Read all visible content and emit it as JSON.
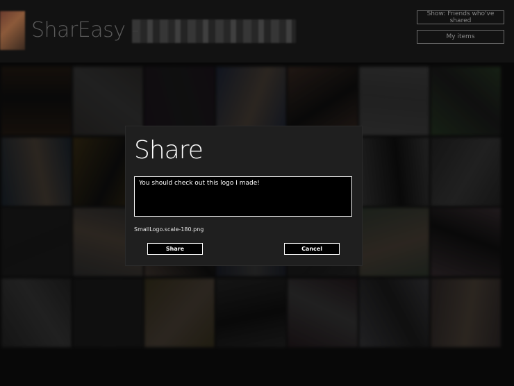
{
  "app": {
    "title": "SharEasy -"
  },
  "header": {
    "filter_button_label": "Show: Friends who've shared",
    "my_items_button_label": "My items"
  },
  "dialog": {
    "title": "Share",
    "message": "You should check out this logo I made!",
    "filename": "SmallLogo.scale-180.png",
    "share_label": "Share",
    "cancel_label": "Cancel"
  },
  "tiles": [
    "#3b2b1f",
    "#4a4744",
    "#2e2030",
    "#2f3b58",
    "#5a4236",
    "#6a6a6a",
    "#3f5a3a",
    "#2a3a4a",
    "#5c4a20",
    "#6e6e6e",
    "#3a2a2a",
    "#2a2a2a",
    "#5a5a5a",
    "#3a3a3a",
    "#2f2f2f",
    "#4a4a4a",
    "#6a5a50",
    "#2a3040",
    "#3a3a3a",
    "#4b5a4a",
    "#5a4a50",
    "#3a3a3a",
    "#2a2a2a",
    "#5a5030",
    "#3b3b3b",
    "#3a2a30",
    "#5a5a60",
    "#4a4040"
  ]
}
